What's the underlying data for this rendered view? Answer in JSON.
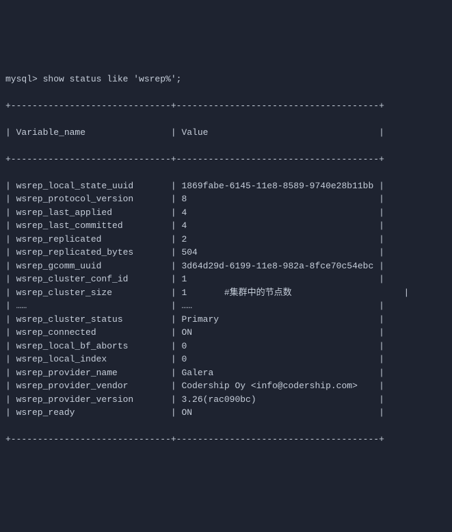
{
  "prompt": "mysql> show status like 'wsrep%';",
  "divider": "+------------------------------+--------------------------------------+",
  "header": {
    "col1": "| Variable_name                | Value                                |"
  },
  "rows": [
    {
      "var": "wsrep_local_state_uuid",
      "val": "1869fabe-6145-11e8-8589-9740e28b11bb"
    },
    {
      "var": "wsrep_protocol_version",
      "val": "8"
    },
    {
      "var": "wsrep_last_applied",
      "val": "4"
    },
    {
      "var": "wsrep_last_committed",
      "val": "4"
    },
    {
      "var": "wsrep_replicated",
      "val": "2"
    },
    {
      "var": "wsrep_replicated_bytes",
      "val": "504"
    },
    {
      "var": "wsrep_gcomm_uuid",
      "val": "3d64d29d-6199-11e8-982a-8fce70c54ebc"
    },
    {
      "var": "wsrep_cluster_conf_id",
      "val": "1"
    },
    {
      "var": "wsrep_cluster_size",
      "val": "1       #集群中的节点数"
    },
    {
      "var": "……",
      "val": "……"
    },
    {
      "var": "wsrep_cluster_status",
      "val": "Primary"
    },
    {
      "var": "wsrep_connected",
      "val": "ON"
    },
    {
      "var": "wsrep_local_bf_aborts",
      "val": "0"
    },
    {
      "var": "wsrep_local_index",
      "val": "0"
    },
    {
      "var": "wsrep_provider_name",
      "val": "Galera"
    },
    {
      "var": "wsrep_provider_vendor",
      "val": "Codership Oy <info@codership.com>"
    },
    {
      "var": "wsrep_provider_version",
      "val": "3.26(rac090bc)"
    },
    {
      "var": "wsrep_ready",
      "val": "ON"
    }
  ]
}
